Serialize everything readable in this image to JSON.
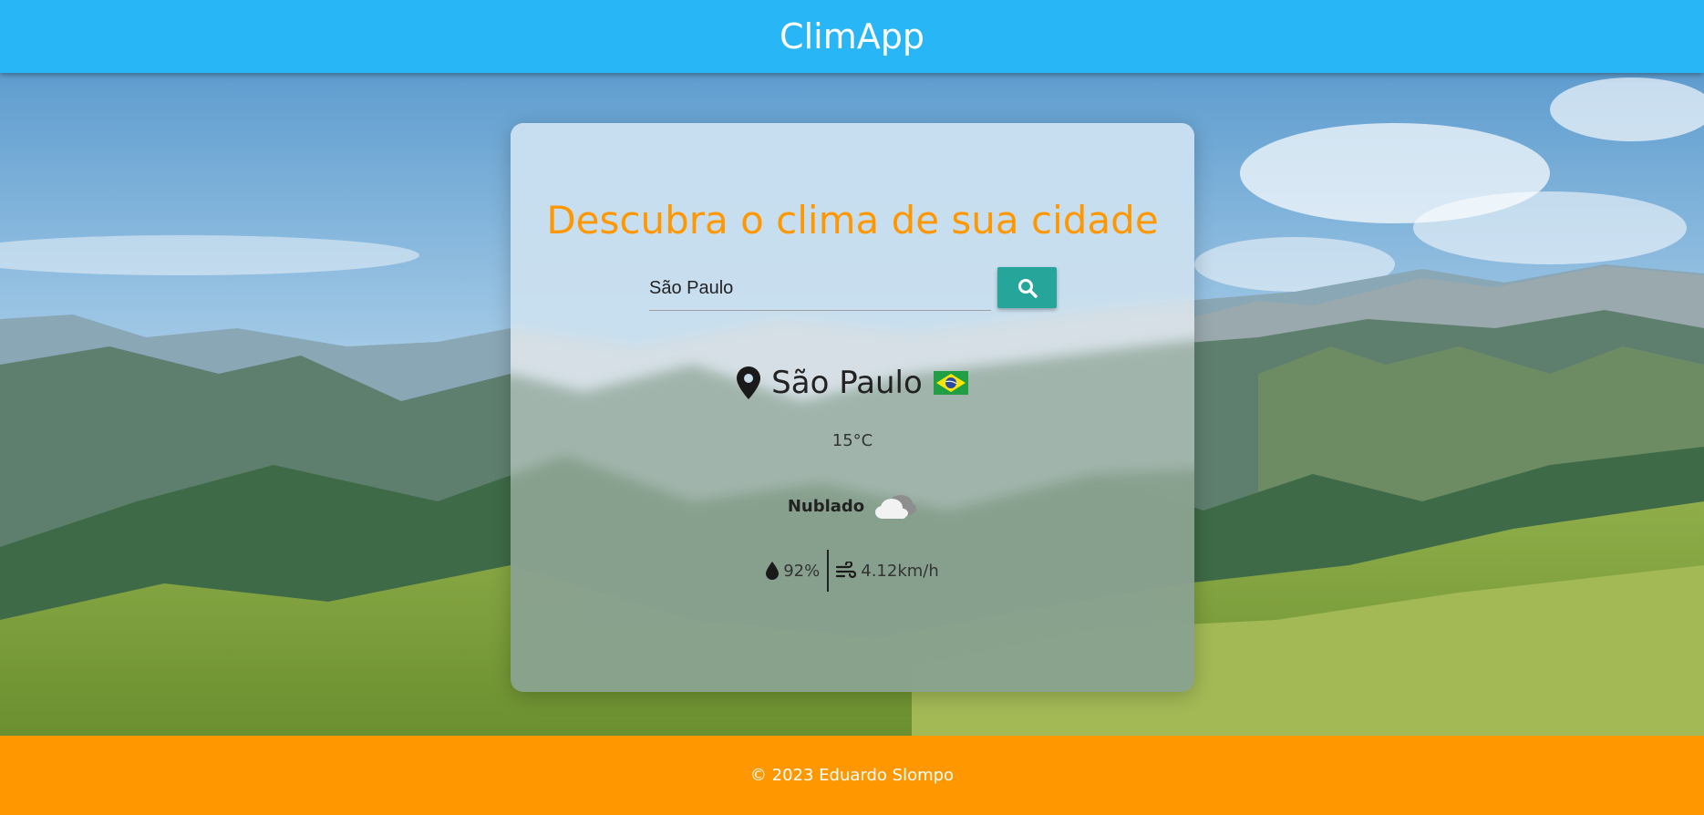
{
  "header": {
    "title": "ClimApp"
  },
  "main": {
    "title": "Descubra o clima de sua cidade",
    "search": {
      "value": "São Paulo",
      "placeholder": ""
    },
    "weather": {
      "city": "São Paulo",
      "temperature": "15°C",
      "description": "Nublado",
      "humidity": "92%",
      "wind": "4.12km/h"
    }
  },
  "icons": {
    "location": "map-marker-icon",
    "flag": "brazil-flag-icon",
    "weather": "cloud-icon",
    "humidity": "droplet-icon",
    "wind": "wind-icon",
    "search": "search-icon"
  },
  "colors": {
    "header": "#29b6f6",
    "accent": "#ff9800",
    "button": "#26a69a",
    "footer": "#ff9800"
  },
  "footer": {
    "text": "© 2023 Eduardo Slompo"
  }
}
